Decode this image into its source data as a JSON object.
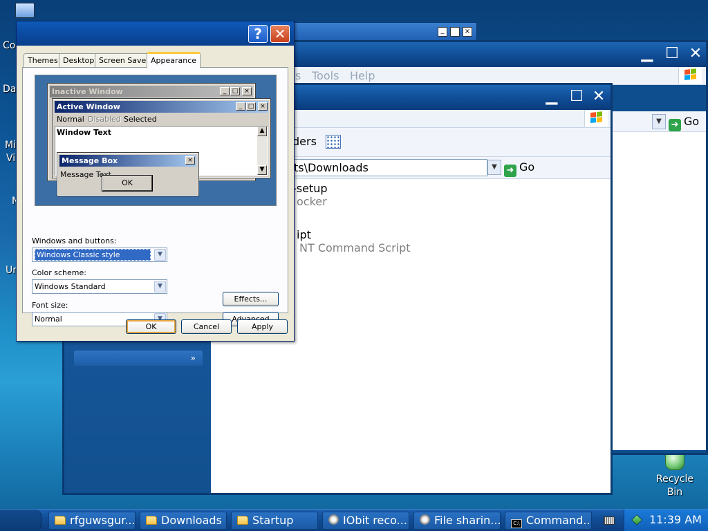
{
  "desktop": {
    "icon_labels": [
      "Co",
      "Da",
      "Mi",
      "Vi",
      "N",
      "Ur"
    ],
    "recycle_bin": [
      "Recycle",
      "Bin"
    ]
  },
  "back_window": {
    "menu": [
      "s",
      "Tools",
      "Help"
    ],
    "go_label": "Go"
  },
  "front_window": {
    "toolbar_text": "ders",
    "address": "My Documents\\Downloads",
    "go_label": "Go",
    "files": [
      {
        "name": "-setup",
        "type": "ocker"
      },
      {
        "name": "ipt",
        "type": "NT Command Script"
      }
    ]
  },
  "dialog": {
    "help": "?",
    "close": "✕",
    "tabs": [
      "Themes",
      "Desktop",
      "Screen Saver",
      "Appearance"
    ],
    "preview": {
      "inactive_title": "Inactive Window",
      "active_title": "Active Window",
      "menu_normal": "Normal",
      "menu_disabled": "Disabled",
      "menu_selected": "Selected",
      "window_text": "Window Text",
      "msgbox_title": "Message Box",
      "msgbox_text": "Message Text",
      "ok": "OK"
    },
    "windows_buttons_label": "Windows and buttons:",
    "windows_buttons_value": "Windows Classic style",
    "color_scheme_label": "Color scheme:",
    "color_scheme_value": "Windows Standard",
    "font_size_label": "Font size:",
    "font_size_value": "Normal",
    "effects": "Effects...",
    "advanced": "Advanced",
    "ok": "OK",
    "cancel": "Cancel",
    "apply": "Apply"
  },
  "taskbar": {
    "buttons": [
      "rfguwsgur...",
      "Downloads",
      "Startup",
      "IObit reco...",
      "File sharin...",
      "Command..."
    ],
    "clock": "11:39 AM"
  },
  "colors": {
    "dialog_bg": "#ece9d8",
    "taskbar": "#124e96",
    "selection": "#316ac5"
  }
}
